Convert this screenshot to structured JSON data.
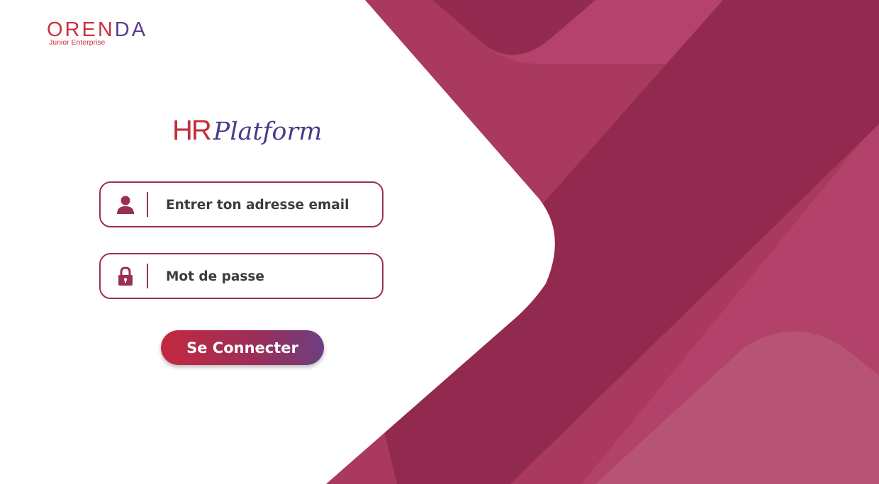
{
  "brand": {
    "name_part1": "ORE",
    "name_part2": "N",
    "name_part3": "DA",
    "tagline": "Junior Enterprise"
  },
  "app_title": {
    "prefix": "HR",
    "suffix": "Platform"
  },
  "login_form": {
    "email_placeholder": "Entrer ton adresse email",
    "email_value": "",
    "password_placeholder": "Mot de passe",
    "password_value": "",
    "submit_label": "Se Connecter"
  },
  "icons": {
    "email": "user-icon",
    "password": "lock-icon"
  },
  "colors": {
    "accent": "#9a2f55",
    "brand_red": "#c8323f",
    "brand_purple": "#5a3d8f",
    "background_panel": "#a8385e"
  }
}
